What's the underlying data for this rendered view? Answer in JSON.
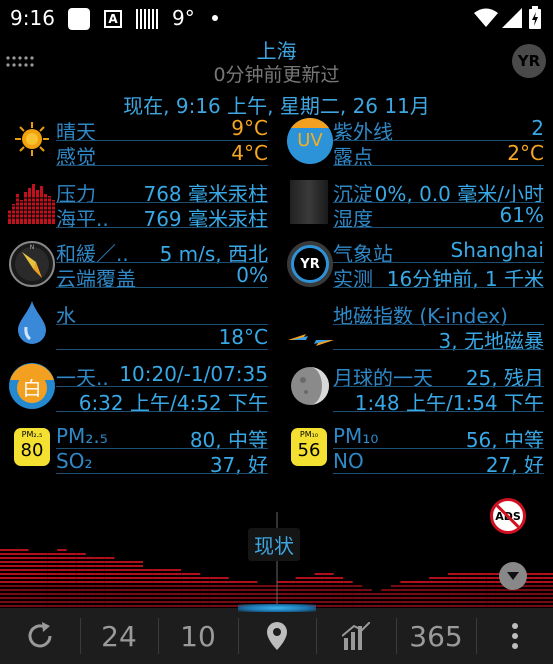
{
  "status_bar": {
    "time": "9:16",
    "temp": "9°"
  },
  "header": {
    "city": "上海",
    "updated": "0分钟前更新过",
    "now": "现在, 9:16 上午, 星期二, 26 11月",
    "logo": "YR"
  },
  "left": [
    {
      "icon": "sun-icon",
      "rows": [
        {
          "label": "晴天",
          "value": "9°C",
          "color": "orange"
        },
        {
          "label": "感觉",
          "value": "4°C",
          "color": "orange"
        }
      ]
    },
    {
      "icon": "pressure-chart-icon",
      "rows": [
        {
          "label": "压力",
          "value": "768 毫米汞柱"
        },
        {
          "label": "海平..",
          "value": "769 毫米汞柱"
        }
      ]
    },
    {
      "icon": "compass-icon",
      "rows": [
        {
          "label": "和緩／..",
          "value": "5 m/s, 西北"
        },
        {
          "label": "云端覆盖",
          "value": "0%"
        }
      ]
    },
    {
      "icon": "water-drop-icon",
      "rows": [
        {
          "label": "水",
          "value": ""
        },
        {
          "label": "",
          "value": "18°C"
        }
      ]
    },
    {
      "icon": "day-icon",
      "rows": [
        {
          "label": "一天..",
          "value": "10:20/-1/07:35"
        },
        {
          "label": "",
          "value": "6:32 上午/4:52 下午"
        }
      ]
    },
    {
      "icon": "pm25-icon",
      "badge_top": "PM₂.₅",
      "badge_num": "80",
      "rows": [
        {
          "label": "PM₂.₅",
          "value": "80, 中等"
        },
        {
          "label": "SO₂",
          "value": "37, 好"
        }
      ]
    }
  ],
  "right": [
    {
      "icon": "uv-icon",
      "icon_text": "UV",
      "rows": [
        {
          "label": "紫外线",
          "value": "2"
        },
        {
          "label": "露点",
          "value": "2°C",
          "color": "orange"
        }
      ]
    },
    {
      "icon": "precipitation-icon",
      "rows": [
        {
          "label": "沉淀",
          "value": "0%, 0.0 毫米/小时"
        },
        {
          "label": "湿度",
          "value": "61%"
        }
      ]
    },
    {
      "icon": "station-icon",
      "icon_text": "YR",
      "rows": [
        {
          "label": "气象站",
          "value": "Shanghai"
        },
        {
          "label": "实测",
          "value": "16分钟前, 1 千米"
        }
      ]
    },
    {
      "icon": "kindex-icon",
      "rows": [
        {
          "label": "地磁指数 (K-index)",
          "value": ""
        },
        {
          "label": "",
          "value": "3, 无地磁暴"
        }
      ]
    },
    {
      "icon": "moon-icon",
      "rows": [
        {
          "label": "月球的一天",
          "value": "25, 残月"
        },
        {
          "label": "",
          "value": "1:48 上午/1:54 下午"
        }
      ]
    },
    {
      "icon": "pm10-icon",
      "badge_top": "PM₁₀",
      "badge_num": "56",
      "rows": [
        {
          "label": "PM₁₀",
          "value": "56, 中等"
        },
        {
          "label": "NO",
          "value": "27, 好"
        }
      ]
    }
  ],
  "graph": {
    "now_label": "现状",
    "ads_label": "ADS"
  },
  "nav": {
    "b24": "24",
    "b10": "10",
    "b365": "365"
  }
}
